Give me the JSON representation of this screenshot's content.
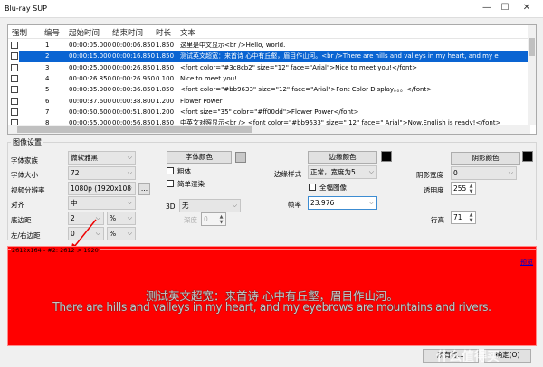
{
  "window": {
    "title": "Blu-ray SUP",
    "minimize": "—",
    "maximize": "☐",
    "close": "✕"
  },
  "table": {
    "columns": [
      "强制",
      "编号",
      "起始时间",
      "结束时间",
      "时长",
      "文本"
    ],
    "rows": [
      {
        "forced": false,
        "num": "1",
        "start": "00:00:05.000",
        "end": "00:00:06.850",
        "dur": "1.850",
        "text": "这里是中文显示<br />Hello, world."
      },
      {
        "forced": false,
        "num": "2",
        "start": "00:00:15.000",
        "end": "00:00:16.850",
        "dur": "1.850",
        "text": "测试英文超宽：来首诗 心中有丘壑，眉目作山河。<br />There are hills and valleys in my heart, and my e",
        "selected": true
      },
      {
        "forced": false,
        "num": "3",
        "start": "00:00:25.000",
        "end": "00:00:26.850",
        "dur": "1.850",
        "text": "<font color=\"#3c8cb2\" size=\"12\" face=\"Arial\">Nice to meet you!</font>"
      },
      {
        "forced": false,
        "num": "4",
        "start": "00:00:26.850",
        "end": "00:00:26.950",
        "dur": "0.100",
        "text": "Nice to meet you!"
      },
      {
        "forced": false,
        "num": "5",
        "start": "00:00:35.000",
        "end": "00:00:36.850",
        "dur": "1.850",
        "text": "<font color=\"#bb9633\" size=\"12\" face=\"Arial\">Font Color Display。。。</font>"
      },
      {
        "forced": false,
        "num": "6",
        "start": "00:00:37.600",
        "end": "00:00:38.800",
        "dur": "1.200",
        "text": "Flower Power"
      },
      {
        "forced": false,
        "num": "7",
        "start": "00:00:50.600",
        "end": "00:00:51.800",
        "dur": "1.200",
        "text": "<font size=\"35\" color=\"#ff00dd\">Flower Power</font>"
      },
      {
        "forced": false,
        "num": "8",
        "start": "00:00:55.000",
        "end": "00:00:56.850",
        "dur": "1.850",
        "text": "中英文对照显示<br /> <font color=\"#bb9633\" size=\" 12\" face=\" Arial\">Now.English is ready!</font>"
      }
    ]
  },
  "settings": {
    "group_label": "图像设置",
    "font_family_label": "字体家族",
    "font_family": "微软雅黑",
    "font_size_label": "字体大小",
    "font_size": "72",
    "resolution_label": "视频分辨率",
    "resolution": "1080p (1920x108",
    "resolution_more": "...",
    "align_label": "对齐",
    "align": "中",
    "bottom_margin_label": "底边距",
    "bottom_margin": "2",
    "bottom_margin_unit": "%",
    "lr_margin_label": "左/右边距",
    "lr_margin": "0",
    "lr_margin_unit": "%",
    "font_color_button": "字体颜色",
    "bold_label": "粗体",
    "simple_render_label": "简单渲染",
    "threed_label": "3D",
    "threed": "无",
    "depth_label": "深度",
    "depth": "0",
    "border_color_button": "边缘颜色",
    "border_style_label": "边缘样式",
    "border_style": "正常，宽度为5",
    "fullframe_label": "全幅图像",
    "framerate_label": "帧率",
    "framerate": "23.976",
    "shadow_color_button": "阴影颜色",
    "shadow_width_label": "阴影宽度",
    "shadow_width": "0",
    "opacity_label": "透明度",
    "opacity": "255",
    "line_spacing_label": "行高",
    "line_spacing": "71",
    "colors": {
      "font": "#c8c8c8",
      "border": "#000000",
      "shadow": "#000000"
    }
  },
  "preview": {
    "info": "2612x164 - #2: 2612 > 1920",
    "link": "预览",
    "line1": "测试英文超宽：来首诗 心中有丘壑，眉目作山河。",
    "line2": "There are hills and valleys in my heart, and my eyebrows are mountains and rivers.",
    "bg": "#ff0000"
  },
  "buttons": {
    "export_all": "所有行...",
    "ok": "确定(O)"
  },
  "watermark": "什么值得买"
}
